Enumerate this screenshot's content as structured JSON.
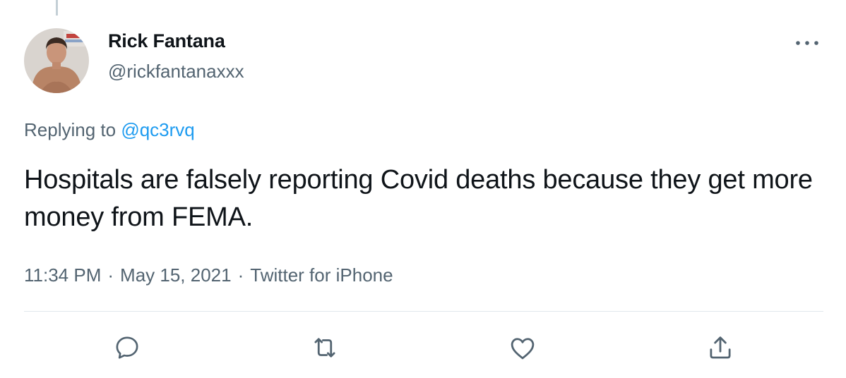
{
  "tweet": {
    "author": {
      "display_name": "Rick Fantana",
      "handle": "@rickfantanaxxx"
    },
    "replying_to_prefix": "Replying to",
    "replying_to_handle": "@qc3rvq",
    "text": "Hospitals are falsely reporting Covid deaths because they get more money from FEMA.",
    "time": "11:34 PM",
    "date": "May 15, 2021",
    "source": "Twitter for iPhone",
    "separator": "·"
  },
  "actions": [
    {
      "icon": "reply-icon"
    },
    {
      "icon": "retweet-icon"
    },
    {
      "icon": "like-icon"
    },
    {
      "icon": "share-icon"
    }
  ],
  "colors": {
    "text_primary": "#0f1419",
    "text_secondary": "#536471",
    "link": "#1d9bf0",
    "divider": "#e1e8ed"
  }
}
